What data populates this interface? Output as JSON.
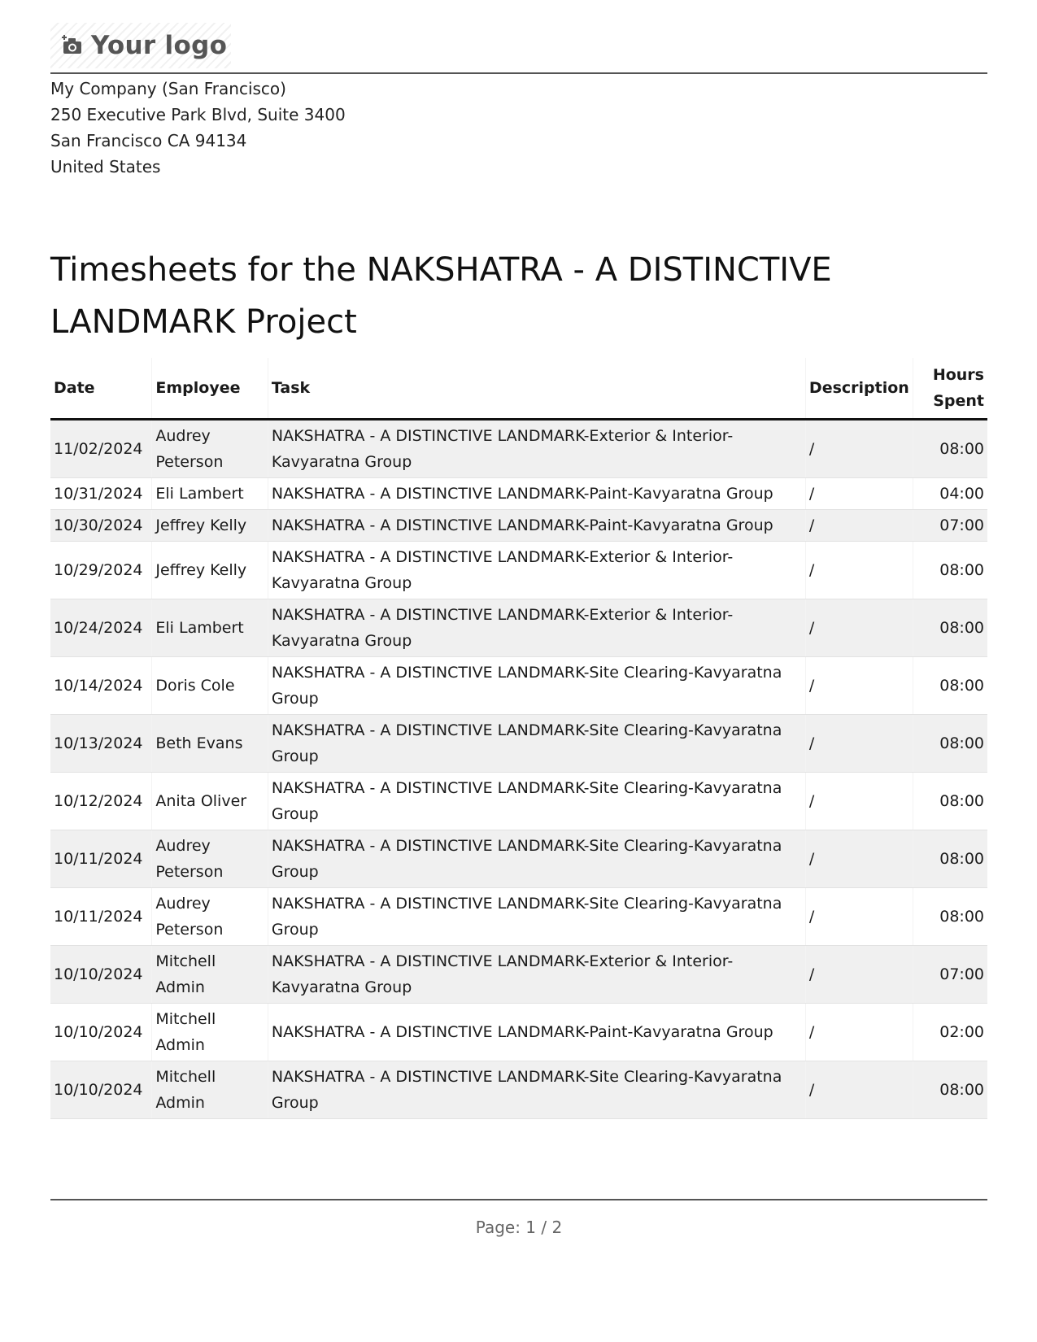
{
  "header": {
    "logo_text": "Your logo",
    "company_address": [
      "My Company (San Francisco)",
      "250 Executive Park Blvd, Suite 3400",
      "San Francisco CA 94134",
      "United States"
    ]
  },
  "document": {
    "title": "Timesheets for the NAKSHATRA - A DISTINCTIVE LANDMARK Project"
  },
  "table": {
    "columns": {
      "date": "Date",
      "employee": "Employee",
      "task": "Task",
      "description": "Description",
      "hours": "Hours Spent"
    },
    "rows": [
      {
        "date": "11/02/2024",
        "employee": "Audrey Peterson",
        "task": "NAKSHATRA - A DISTINCTIVE LANDMARK-Exterior & Interior-Kavyaratna Group",
        "description": "/",
        "hours": "08:00"
      },
      {
        "date": "10/31/2024",
        "employee": "Eli Lambert",
        "task": "NAKSHATRA - A DISTINCTIVE LANDMARK-Paint-Kavyaratna Group",
        "description": "/",
        "hours": "04:00"
      },
      {
        "date": "10/30/2024",
        "employee": "Jeffrey Kelly",
        "task": "NAKSHATRA - A DISTINCTIVE LANDMARK-Paint-Kavyaratna Group",
        "description": "/",
        "hours": "07:00"
      },
      {
        "date": "10/29/2024",
        "employee": "Jeffrey Kelly",
        "task": "NAKSHATRA - A DISTINCTIVE LANDMARK-Exterior & Interior-Kavyaratna Group",
        "description": "/",
        "hours": "08:00"
      },
      {
        "date": "10/24/2024",
        "employee": "Eli Lambert",
        "task": "NAKSHATRA - A DISTINCTIVE LANDMARK-Exterior & Interior-Kavyaratna Group",
        "description": "/",
        "hours": "08:00"
      },
      {
        "date": "10/14/2024",
        "employee": "Doris Cole",
        "task": "NAKSHATRA - A DISTINCTIVE LANDMARK-Site Clearing-Kavyaratna Group",
        "description": "/",
        "hours": "08:00"
      },
      {
        "date": "10/13/2024",
        "employee": "Beth Evans",
        "task": "NAKSHATRA - A DISTINCTIVE LANDMARK-Site Clearing-Kavyaratna Group",
        "description": "/",
        "hours": "08:00"
      },
      {
        "date": "10/12/2024",
        "employee": "Anita Oliver",
        "task": "NAKSHATRA - A DISTINCTIVE LANDMARK-Site Clearing-Kavyaratna Group",
        "description": "/",
        "hours": "08:00"
      },
      {
        "date": "10/11/2024",
        "employee": "Audrey Peterson",
        "task": "NAKSHATRA - A DISTINCTIVE LANDMARK-Site Clearing-Kavyaratna Group",
        "description": "/",
        "hours": "08:00"
      },
      {
        "date": "10/11/2024",
        "employee": "Audrey Peterson",
        "task": "NAKSHATRA - A DISTINCTIVE LANDMARK-Site Clearing-Kavyaratna Group",
        "description": "/",
        "hours": "08:00"
      },
      {
        "date": "10/10/2024",
        "employee": "Mitchell Admin",
        "task": "NAKSHATRA - A DISTINCTIVE LANDMARK-Exterior & Interior-Kavyaratna Group",
        "description": "/",
        "hours": "07:00"
      },
      {
        "date": "10/10/2024",
        "employee": "Mitchell Admin",
        "task": "NAKSHATRA - A DISTINCTIVE LANDMARK-Paint-Kavyaratna Group",
        "description": "/",
        "hours": "02:00"
      },
      {
        "date": "10/10/2024",
        "employee": "Mitchell Admin",
        "task": "NAKSHATRA - A DISTINCTIVE LANDMARK-Site Clearing-Kavyaratna Group",
        "description": "/",
        "hours": "08:00"
      }
    ]
  },
  "footer": {
    "page_text": "Page: 1 / 2"
  }
}
